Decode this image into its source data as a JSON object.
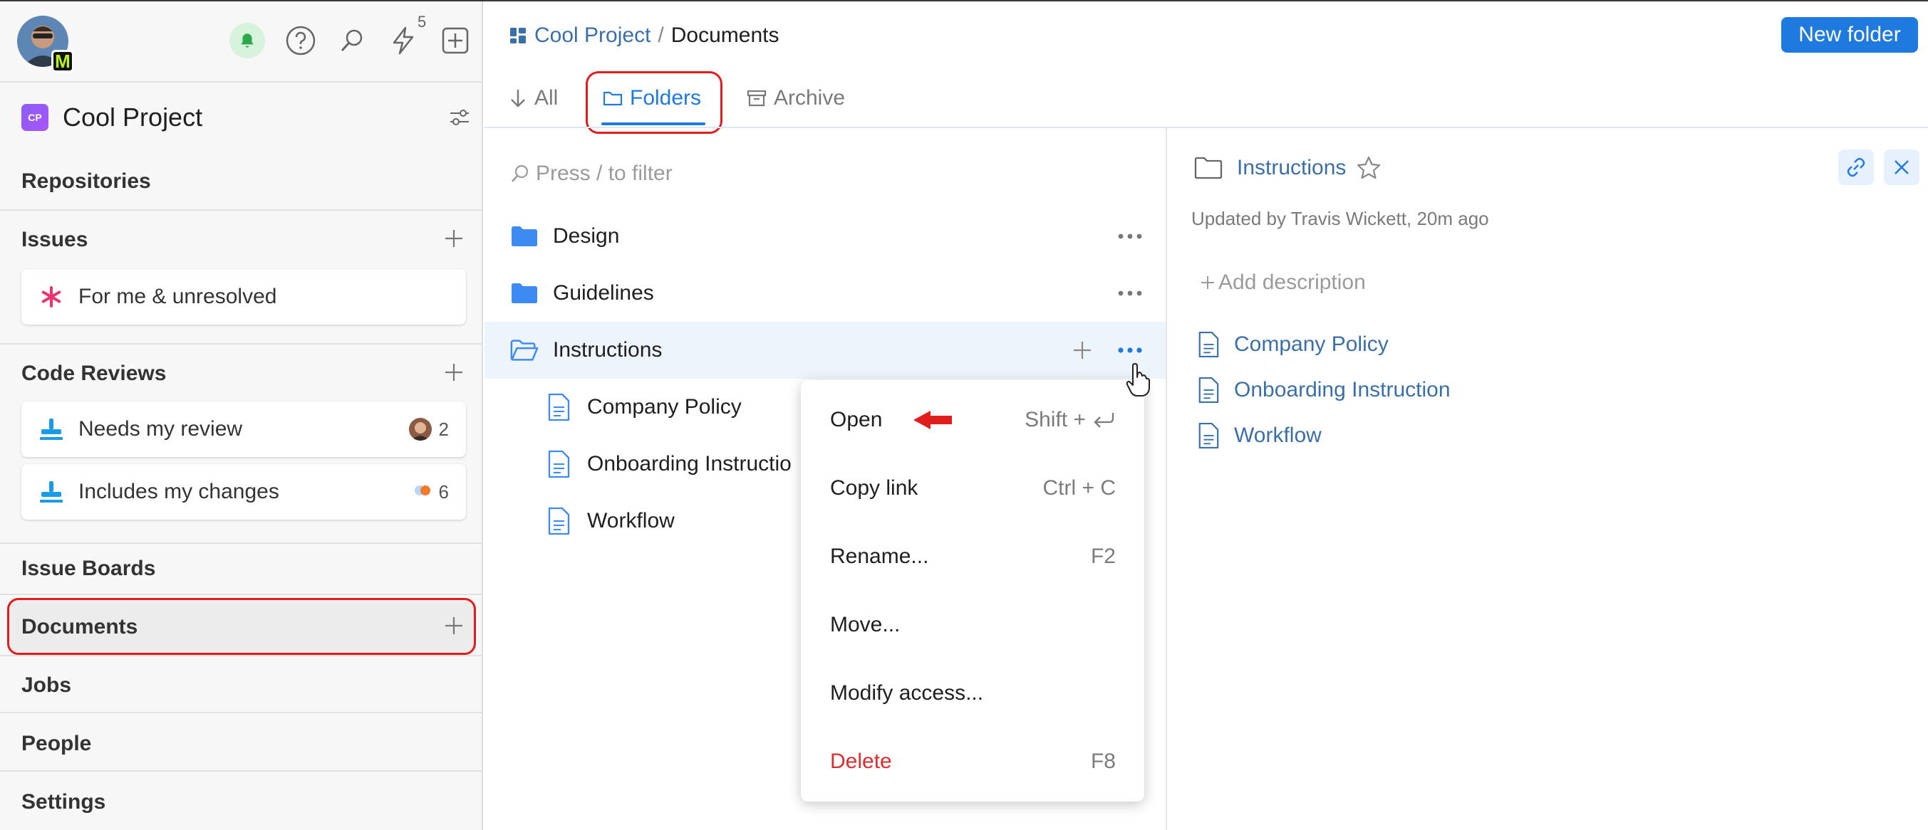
{
  "sidebar": {
    "notifications_count": "5",
    "avatar_badge": "M",
    "project": {
      "logo": "CP",
      "name": "Cool Project"
    },
    "sections": {
      "repositories": "Repositories",
      "issues": "Issues",
      "issues_items": [
        {
          "label": "For me & unresolved"
        }
      ],
      "code_reviews": "Code Reviews",
      "code_review_items": [
        {
          "label": "Needs my review",
          "count": "2"
        },
        {
          "label": "Includes my changes",
          "count": "6"
        }
      ],
      "issue_boards": "Issue Boards",
      "documents": "Documents",
      "jobs": "Jobs",
      "people": "People",
      "settings": "Settings"
    }
  },
  "header": {
    "breadcrumb_project": "Cool Project",
    "breadcrumb_sep": "/",
    "breadcrumb_current": "Documents",
    "new_folder_label": "New folder",
    "tabs": [
      {
        "label": "All",
        "active": false
      },
      {
        "label": "Folders",
        "active": true
      },
      {
        "label": "Archive",
        "active": false
      }
    ]
  },
  "list": {
    "filter_placeholder": "Press / to filter",
    "folders": [
      {
        "label": "Design"
      },
      {
        "label": "Guidelines"
      },
      {
        "label": "Instructions",
        "selected": true
      }
    ],
    "documents": [
      {
        "label": "Company Policy"
      },
      {
        "label": "Onboarding Instructio"
      },
      {
        "label": "Workflow"
      }
    ]
  },
  "context_menu": {
    "items": [
      {
        "label": "Open",
        "shortcut": "Shift +"
      },
      {
        "label": "Copy link",
        "shortcut": "Ctrl + C"
      },
      {
        "label": "Rename...",
        "shortcut": "F2"
      },
      {
        "label": "Move...",
        "shortcut": ""
      },
      {
        "label": "Modify access...",
        "shortcut": ""
      },
      {
        "label": "Delete",
        "shortcut": "F8"
      }
    ]
  },
  "details": {
    "title": "Instructions",
    "updated": "Updated by Travis Wickett, 20m ago",
    "add_description": "Add description",
    "documents": [
      {
        "label": "Company Policy"
      },
      {
        "label": "Onboarding Instruction"
      },
      {
        "label": "Workflow"
      }
    ]
  },
  "colors": {
    "accent": "#1f7ae0",
    "link": "#3a6fa8",
    "folder": "#3d8bf2",
    "highlight_annotation": "#e01e1e",
    "danger": "#dd2d2d",
    "issues_star": "#e8356d",
    "review_icon": "#1a9be6"
  }
}
